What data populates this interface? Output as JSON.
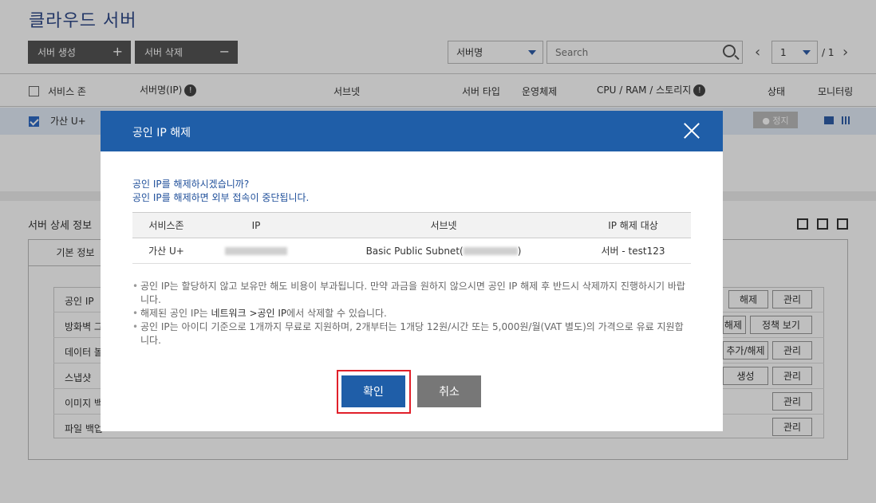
{
  "page": {
    "title": "클라우드 서버",
    "toolbar": {
      "create_label": "서버 생성",
      "create_symbol": "+",
      "delete_label": "서버 삭제",
      "delete_symbol": "−",
      "filter_value": "서버명",
      "search_placeholder": "Search",
      "page_current": "1",
      "page_total": "/ 1"
    },
    "table": {
      "headers": [
        "서비스 존",
        "서버명(IP)",
        "서브넷",
        "서버 타입",
        "운영체제",
        "CPU / RAM / 스토리지",
        "상태",
        "모니터링"
      ],
      "header_info_mark": "!",
      "selected_row": {
        "zone": "가산 U+",
        "status": "● 정지"
      }
    },
    "detail": {
      "title": "서버 상세 정보",
      "tab_label": "기본 정보",
      "rows": [
        {
          "label": "공인 IP",
          "buttons": [
            "해제",
            "관리"
          ]
        },
        {
          "label": "방화벽 그룹",
          "buttons": [
            "해제",
            "정책 보기"
          ]
        },
        {
          "label": "데이터 볼륨",
          "buttons": [
            "추가/해제",
            "관리"
          ]
        },
        {
          "label": "스냅샷",
          "buttons": [
            "생성",
            "관리"
          ]
        },
        {
          "label": "이미지 백업",
          "buttons": [
            "관리"
          ]
        },
        {
          "label": "파일 백업",
          "buttons": [
            "관리"
          ]
        }
      ]
    }
  },
  "modal": {
    "title": "공인 IP 해제",
    "message_line1": "공인 IP를 해제하시겠습니까?",
    "message_line2": "공인 IP를 해제하면 외부 접속이 중단됩니다.",
    "table": {
      "headers": [
        "서비스존",
        "IP",
        "서브넷",
        "IP 해제 대상"
      ],
      "row": {
        "zone": "가산 U+",
        "subnet_prefix": "Basic Public Subnet(",
        "subnet_suffix": ")",
        "target": "서버 - test123"
      }
    },
    "notes": {
      "note1": "공인 IP는 할당하지 않고 보유만 해도 비용이 부과됩니다. 만약 과금을 원하지 않으시면 공인 IP 해제 후 반드시 삭제까지 진행하시기 바랍니다.",
      "note2_pre": "해제된 공인 IP는 ",
      "note2_bold": "네트워크 >공인 IP",
      "note2_post": "에서 삭제할 수 있습니다.",
      "note3": "공인 IP는 아이디 기준으로 1개까지 무료로 지원하며, 2개부터는 1개당 12원/시간 또는 5,000원/월(VAT 별도)의 가격으로 유료 지원합니다."
    },
    "confirm_label": "확인",
    "cancel_label": "취소"
  },
  "colors": {
    "brand_blue": "#1f5ea8",
    "highlight_red": "#e0202a",
    "cancel_gray": "#777777"
  }
}
